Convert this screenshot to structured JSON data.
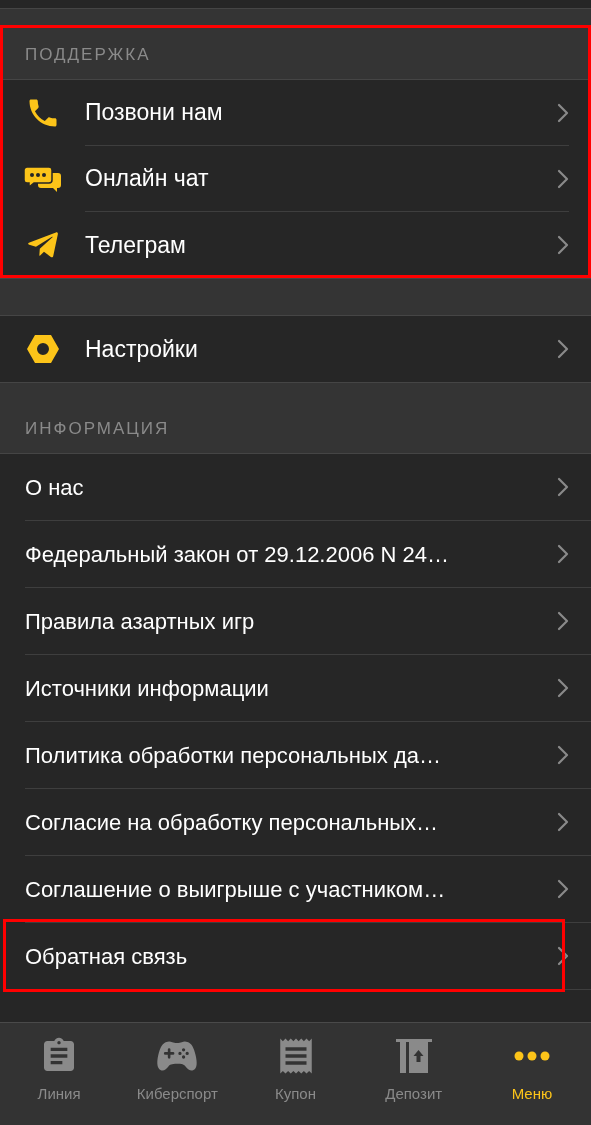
{
  "support": {
    "header": "ПОДДЕРЖКА",
    "highlighted": true,
    "items": [
      {
        "label": "Позвони нам"
      },
      {
        "label": "Онлайн чат"
      },
      {
        "label": "Телеграм"
      }
    ]
  },
  "settings": {
    "label": "Настройки"
  },
  "info": {
    "header": "ИНФОРМАЦИЯ",
    "items": [
      {
        "label": "О нас",
        "highlighted": false
      },
      {
        "label": "Федеральный закон от 29.12.2006 N 24…",
        "highlighted": false
      },
      {
        "label": "Правила азартных игр",
        "highlighted": false
      },
      {
        "label": "Источники информации",
        "highlighted": false
      },
      {
        "label": "Политика обработки персональных да…",
        "highlighted": false
      },
      {
        "label": "Согласие на обработку персональных…",
        "highlighted": false
      },
      {
        "label": "Соглашение о выигрыше с участником…",
        "highlighted": false
      },
      {
        "label": "Обратная связь",
        "highlighted": true
      }
    ]
  },
  "tab_bar": [
    {
      "label": "Линия",
      "selected": false
    },
    {
      "label": "Киберспорт",
      "selected": false
    },
    {
      "label": "Купон",
      "selected": false
    },
    {
      "label": "Депозит",
      "selected": false
    },
    {
      "label": "Меню",
      "selected": true
    }
  ]
}
